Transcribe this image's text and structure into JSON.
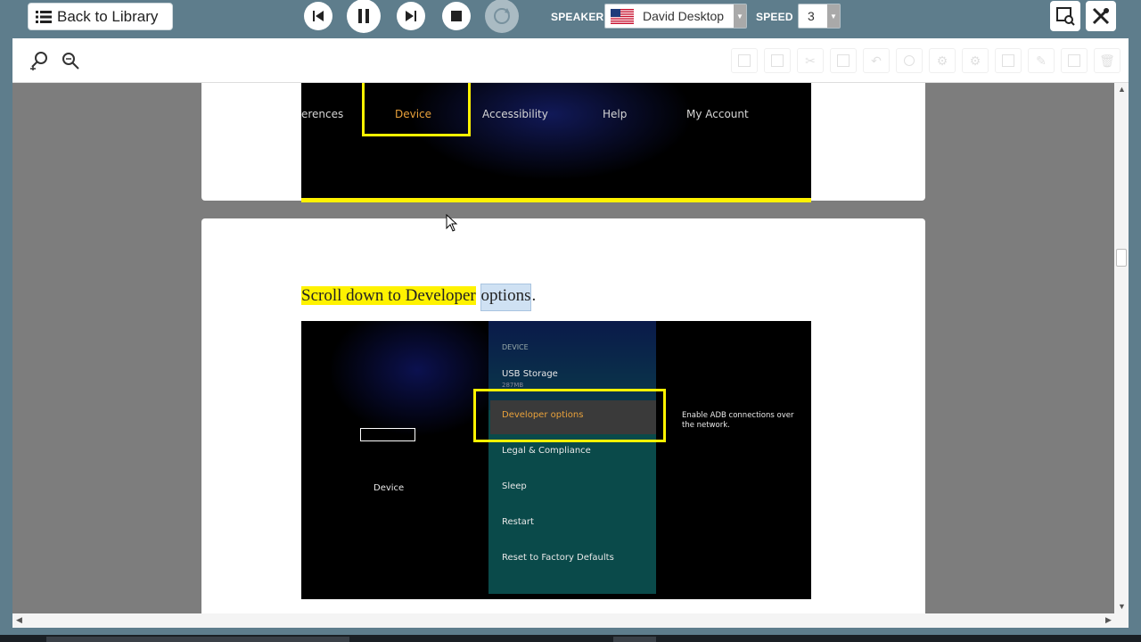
{
  "toolbar": {
    "back_label": "Back to Library",
    "speaker_label": "SPEAKER",
    "speaker_value": "David Desktop",
    "speed_label": "SPEED",
    "speed_value": "3"
  },
  "document": {
    "page1": {
      "menu": [
        "erences",
        "Device",
        "Accessibility",
        "Help",
        "My Account"
      ],
      "active_item": "Device"
    },
    "page2": {
      "caption_highlight": "Scroll down to Developer",
      "caption_selected": "options",
      "caption_end": ".",
      "screenshot": {
        "section_header": "DEVICE",
        "items": [
          "USB Storage",
          "Developer options",
          "Legal & Compliance",
          "Sleep",
          "Restart",
          "Reset to Factory Defaults"
        ],
        "usb_sub": "287MB",
        "left_label": "Device",
        "description": "Enable ADB connections over the network."
      }
    }
  },
  "colors": {
    "accent_yellow": "#fff200",
    "toolbar_bg": "#5e7d8c",
    "menu_active": "#e9a13b"
  }
}
